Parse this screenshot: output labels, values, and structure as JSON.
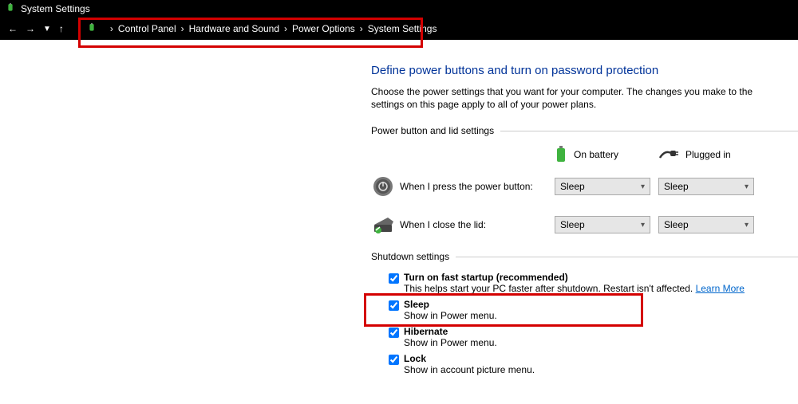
{
  "window": {
    "title": "System Settings"
  },
  "breadcrumb": {
    "items": [
      "Control Panel",
      "Hardware and Sound",
      "Power Options",
      "System Settings"
    ]
  },
  "main": {
    "heading": "Define power buttons and turn on password protection",
    "description": "Choose the power settings that you want for your computer. The changes you make to the settings on this page apply to all of your power plans.",
    "section1": {
      "title": "Power button and lid settings",
      "col_battery": "On battery",
      "col_plugged": "Plugged in",
      "rows": [
        {
          "label": "When I press the power button:",
          "battery": "Sleep",
          "plugged": "Sleep"
        },
        {
          "label": "When I close the lid:",
          "battery": "Sleep",
          "plugged": "Sleep"
        }
      ]
    },
    "section2": {
      "title": "Shutdown settings",
      "items": [
        {
          "label": "Turn on fast startup (recommended)",
          "desc_before": "This helps start your PC faster after shutdown. Restart isn't affected. ",
          "link": "Learn More",
          "checked": true
        },
        {
          "label": "Sleep",
          "desc": "Show in Power menu.",
          "checked": true
        },
        {
          "label": "Hibernate",
          "desc": "Show in Power menu.",
          "checked": true
        },
        {
          "label": "Lock",
          "desc": "Show in account picture menu.",
          "checked": true
        }
      ]
    }
  }
}
